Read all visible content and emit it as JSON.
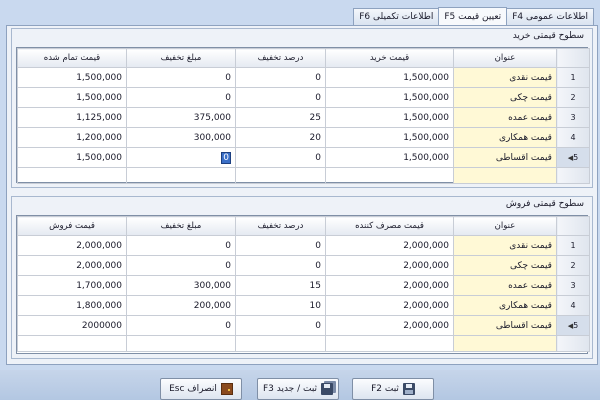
{
  "tabs": [
    {
      "label": "اطلاعات تکمیلی F6"
    },
    {
      "label": "تعیین قیمت F5"
    },
    {
      "label": "اطلاعات عمومی F4"
    }
  ],
  "purchase": {
    "group_title": "سطوح قیمتی خرید",
    "columns": [
      "عنوان",
      "قیمت خرید",
      "درصد تخفیف",
      "مبلغ تخفیف",
      "قیمت تمام شده"
    ],
    "rows": [
      {
        "no": "1",
        "title": "قیمت نقدی",
        "price": "1,500,000",
        "percent": "0",
        "discount": "0",
        "final": "1,500,000"
      },
      {
        "no": "2",
        "title": "قیمت چکی",
        "price": "1,500,000",
        "percent": "0",
        "discount": "0",
        "final": "1,500,000"
      },
      {
        "no": "3",
        "title": "قیمت عمده",
        "price": "1,500,000",
        "percent": "25",
        "discount": "375,000",
        "final": "1,125,000"
      },
      {
        "no": "4",
        "title": "قیمت همکاری",
        "price": "1,500,000",
        "percent": "20",
        "discount": "300,000",
        "final": "1,200,000"
      },
      {
        "no": "5",
        "title": "قیمت اقساطی",
        "price": "1,500,000",
        "percent": "0",
        "discount": "0",
        "final": "1,500,000"
      }
    ]
  },
  "sales": {
    "group_title": "سطوح قیمتی فروش",
    "columns": [
      "عنوان",
      "قیمت مصرف کننده",
      "درصد تخفیف",
      "مبلغ تخفیف",
      "قیمت فروش"
    ],
    "rows": [
      {
        "no": "1",
        "title": "قیمت نقدی",
        "price": "2,000,000",
        "percent": "0",
        "discount": "0",
        "final": "2,000,000"
      },
      {
        "no": "2",
        "title": "قیمت چکی",
        "price": "2,000,000",
        "percent": "0",
        "discount": "0",
        "final": "2,000,000"
      },
      {
        "no": "3",
        "title": "قیمت عمده",
        "price": "2,000,000",
        "percent": "15",
        "discount": "300,000",
        "final": "1,700,000"
      },
      {
        "no": "4",
        "title": "قیمت همکاری",
        "price": "2,000,000",
        "percent": "10",
        "discount": "200,000",
        "final": "1,800,000"
      },
      {
        "no": "5",
        "title": "قیمت اقساطی",
        "price": "2,000,000",
        "percent": "0",
        "discount": "0",
        "final": "2000000"
      }
    ]
  },
  "buttons": {
    "cancel": "انصراف Esc",
    "save_new": "ثبت / جدید F3",
    "save": "ثبت F2"
  },
  "icons": {
    "cancel": "exit-door-icon",
    "save_new": "multi-floppy-icon",
    "save": "floppy-icon"
  },
  "colors": {
    "title_cell": "#fff9d6",
    "selection": "#3b6fc7",
    "background": "#c9d9ef"
  }
}
